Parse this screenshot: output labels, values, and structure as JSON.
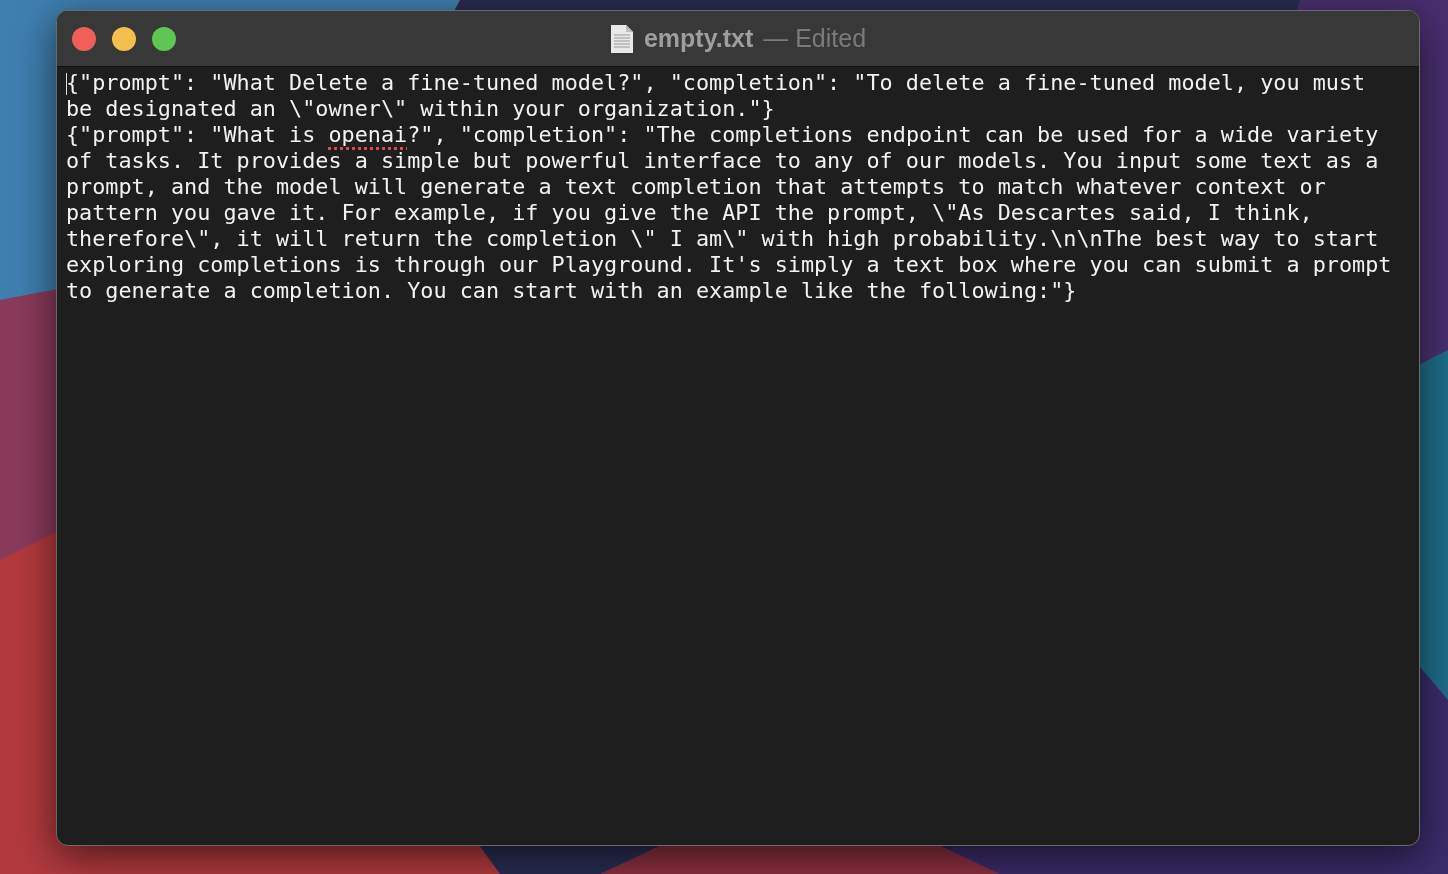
{
  "window": {
    "filename": "empty.txt",
    "status": "— Edited"
  },
  "document": {
    "cursor_visible": true,
    "paragraphs": [
      {
        "segments": [
          {
            "text": "{\"prompt\": \"What Delete a fine-tuned model?\", \"completion\": \"To delete a fine-tuned model, you must be designated an \\\"owner\\\" within your organization.\"}",
            "misspelled": false
          }
        ]
      },
      {
        "segments": [
          {
            "text": "{\"prompt\": \"What is ",
            "misspelled": false
          },
          {
            "text": "openai",
            "misspelled": true
          },
          {
            "text": "?\", \"completion\": \"The completions endpoint can be used for a wide variety of tasks. It provides a simple but powerful interface to any of our models. You input some text as a prompt, and the model will generate a text completion that attempts to match whatever context or pattern you gave it. For example, if you give the API the prompt, \\\"As Descartes said, I think, therefore\\\", it will return the completion \\\" I am\\\" with high probability.\\n\\nThe best way to start exploring completions is through our Playground. It's simply a text box where you can submit a prompt to generate a completion. You can start with an example like the following:\"}",
            "misspelled": false
          }
        ]
      }
    ]
  }
}
